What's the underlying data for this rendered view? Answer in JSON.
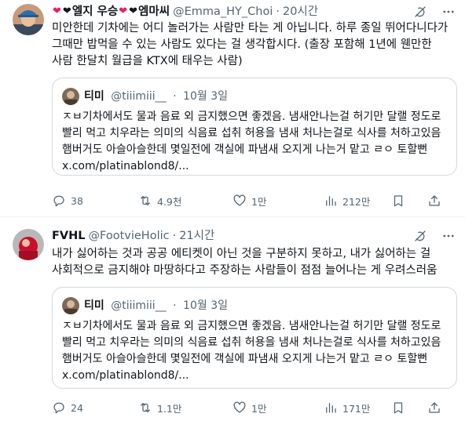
{
  "tweets": [
    {
      "display_name": "엘지 우승",
      "display_name_2": "엠마씨",
      "handle": "@Emma_HY_Choi",
      "time": "20시간",
      "text": "미안한데 기차에는 어디 놀러가는 사람만 타는 게 아닙니다. 하루 종일 뛰어다니다가 그때만 밥먹을 수 있는 사람도 있다는 걸 생각합시다. (출장 포함해 1년에 웬만한 사람 한달치 월급을 KTX에 태우는 사람)",
      "quote": {
        "name": "티미",
        "handle": "@tiiimiii__",
        "time": "10월 3일",
        "text": "ㅈㅂ기차에서도 물과 음료 외 금지했으면 좋겠음. 냄새안나는걸 허기만 달랠 정도로 빨리 먹고 치우라는 의미의 식음료 섭취 허용을 냄새 처나는걸로 식사를 처하고있음 햄버거도 아슬아슬한데 몇일전에 객실에 파냄새 오지게 나는거 맡고 ㄹㅇ 토할뻔 x.com/platinablond8/..."
      },
      "stats": {
        "replies": "38",
        "retweets": "4.9천",
        "likes": "1만",
        "views": "212만"
      }
    },
    {
      "display_name": "FVHL",
      "handle": "@FootvieHolic",
      "time": "21시간",
      "text": "내가 싫어하는 것과 공공 에티켓이 아닌 것을 구분하지 못하고, 내가 싫어하는 걸 사회적으로 금지해야 마땅하다고 주장하는 사람들이 점점 늘어나는 게 우려스러움",
      "quote": {
        "name": "티미",
        "handle": "@tiiimiii__",
        "time": "10월 3일",
        "text": "ㅈㅂ기차에서도 물과 음료 외 금지했으면 좋겠음. 냄새안나는걸 허기만 달랠 정도로 빨리 먹고 치우라는 의미의 식음료 섭취 허용을 냄새 처나는걸로 식사를 처하고있음 햄버거도 아슬아슬한데 몇일전에 객실에 파냄새 오지게 나는거 맡고 ㄹㅇ 토할뻔 x.com/platinablond8/..."
      },
      "stats": {
        "replies": "24",
        "retweets": "1.1만",
        "likes": "1만",
        "views": "171만"
      }
    }
  ],
  "colors": {
    "text": "#0f1419",
    "muted": "#536471",
    "border": "#cfd9de",
    "heart_red": "#e0245e"
  },
  "icons": [
    "grok-icon",
    "more-icon",
    "reply-icon",
    "retweet-icon",
    "like-icon",
    "views-icon",
    "bookmark-icon",
    "share-icon"
  ]
}
